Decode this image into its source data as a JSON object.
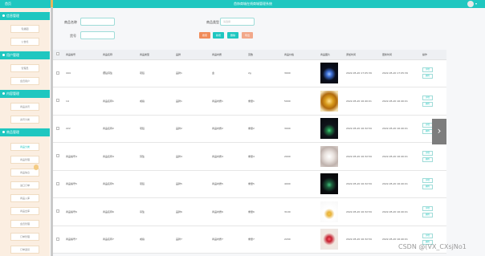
{
  "topbar": {
    "home": "首页",
    "title": "首饰商城在线商城管理系统",
    "drop": "▾"
  },
  "sidebar": {
    "sections": [
      {
        "label": "信息管理",
        "items": [
          "轮播图",
          "公告栏"
        ]
      },
      {
        "label": "用户管理",
        "items": [
          "管理员",
          "会员用户"
        ]
      },
      {
        "label": "内容管理",
        "items": [
          "商品资讯",
          "资讯分类"
        ]
      },
      {
        "label": "商品管理",
        "items": [
          "商品分类",
          "商品管理",
          "商品信息",
          "进口订单",
          "商品入库",
          "商品出库",
          "会员管理",
          "订单管理",
          "订单退货"
        ]
      }
    ]
  },
  "search": {
    "name_label": "商品名称",
    "name_value": "",
    "cat_label": "商品类型",
    "cat_placeholder": "请选择",
    "id_label": "货号",
    "id_value": "",
    "buttons": [
      "搜索",
      "新增",
      "删除",
      "导出"
    ]
  },
  "table": {
    "headers": [
      "商品编号",
      "商品名称",
      "商品类型",
      "品牌",
      "商品材质",
      "克数",
      "商品价格",
      "商品图片",
      "添加时间",
      "更新时间",
      "操作"
    ],
    "actions": [
      "详情",
      "删除",
      "编辑"
    ],
    "rows": [
      [
        "444",
        "镶钻耳坠",
        "项链",
        "品牌1",
        "金",
        "2g",
        "3000",
        "blue",
        "2022-05-20 17:05:39",
        "2022-05-20 17:05:39"
      ],
      [
        "14",
        "商品名称1",
        "戒指",
        "品牌1",
        "商品材质1",
        "重量1",
        "5000",
        "gold-ring",
        "2022-05-20 16:40:01",
        "2022-05-20 16:40:01"
      ],
      [
        "222",
        "商品名称2",
        "项链",
        "品牌2",
        "商品材质2",
        "重量2",
        "3000",
        "green",
        "2022-05-20 16:32:59",
        "2022-05-20 16:40:01"
      ],
      [
        "商品编号4",
        "商品名称4",
        "耳坠",
        "品牌4",
        "商品材质4",
        "重量4",
        "2000",
        "pearl",
        "2022-05-20 16:32:59",
        "2022-05-20 16:40:01"
      ],
      [
        "商品编号5",
        "商品名称5",
        "项链",
        "品牌5",
        "商品材质5",
        "重量5",
        "4000",
        "emerald",
        "2022-05-20 16:32:59",
        "2022-05-20 16:40:01"
      ],
      [
        "商品编号6",
        "商品名称6",
        "吊坠",
        "品牌6",
        "商品材质6",
        "重量6",
        "3100",
        "pendant",
        "2022-05-20 16:32:59",
        "2022-05-20 16:40:01"
      ],
      [
        "商品编号7",
        "商品名称7",
        "戒指",
        "品牌7",
        "商品材质7",
        "重量7",
        "2200",
        "ruby",
        "2022-05-20 16:32:59",
        "2022-05-20 16:40:01"
      ]
    ]
  },
  "next_glyph": "›",
  "watermark": "CSDN @(VX_CXsjNo1",
  "colors": {
    "accent": "#1fc7c0",
    "sidebar_bg": "#fbeee1",
    "btn_orange": "#f08c5a",
    "btn_teal": "#1fc7c0",
    "btn_peach": "#f2a88a"
  }
}
